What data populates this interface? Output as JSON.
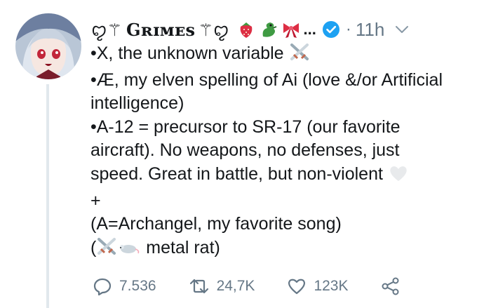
{
  "tweet": {
    "author": {
      "display_name": "Gʀɪᴍᴇs",
      "name_decoration_left": "ꨄ⚚",
      "name_decoration_right": "⚚ꨄ",
      "verified": true,
      "emojis": [
        "strawberry-emoji",
        "dragon-emoji",
        "ribbon-emoji"
      ],
      "more_label": "..."
    },
    "separator": "·",
    "timestamp": "11h",
    "lines": [
      "•X, the unknown variable",
      "•Æ, my elven spelling of Ai (love &/or Artificial",
      "intelligence)",
      "•A-12 = precursor to SR-17 (our favorite",
      "aircraft).  No weapons, no defenses, just",
      "speed.  Great in battle, but non-violent",
      "+",
      "(A=Archangel, my favorite song)",
      "(",
      " metal rat)"
    ],
    "stats": {
      "replies": "7.536",
      "retweets": "24,7K",
      "likes": "123K"
    }
  },
  "colors": {
    "text": "#14171a",
    "muted": "#657786",
    "verified": "#1da1f2",
    "thread_line": "#e1e8ed"
  }
}
